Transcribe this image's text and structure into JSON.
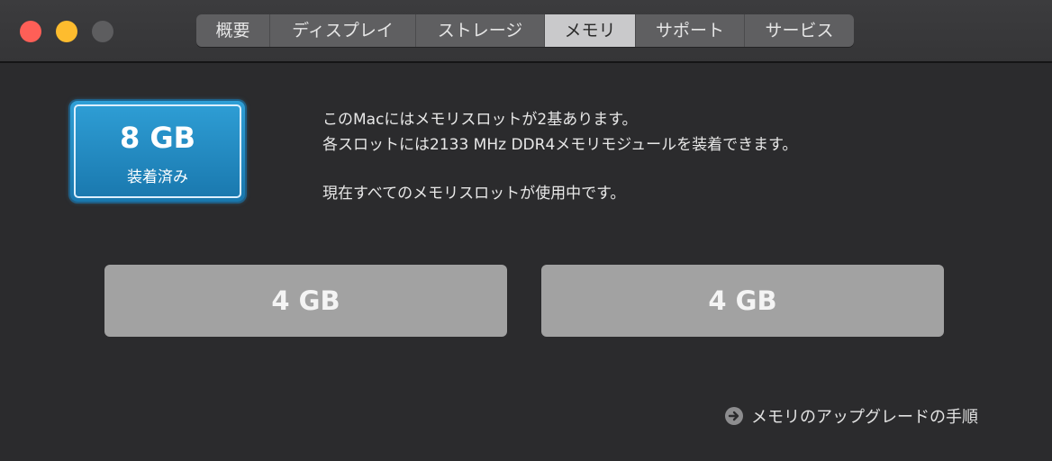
{
  "window": {
    "controls": [
      "close",
      "minimize",
      "zoom"
    ],
    "colors": {
      "close": "#fe5f57",
      "minimize": "#febc2e",
      "zoom": "#5d5d5f"
    }
  },
  "tabs": [
    {
      "label": "概要",
      "selected": false
    },
    {
      "label": "ディスプレイ",
      "selected": false
    },
    {
      "label": "ストレージ",
      "selected": false
    },
    {
      "label": "メモリ",
      "selected": true
    },
    {
      "label": "サポート",
      "selected": false
    },
    {
      "label": "サービス",
      "selected": false
    }
  ],
  "summary": {
    "size": "8 GB",
    "label": "装着済み"
  },
  "info": {
    "line1": "このMacにはメモリスロットが2基あります。",
    "line2": "各スロットには2133 MHz DDR4メモリモジュールを装着できます。",
    "line3": "現在すべてのメモリスロットが使用中です。"
  },
  "slots": [
    {
      "size": "4 GB"
    },
    {
      "size": "4 GB"
    }
  ],
  "upgrade_link": {
    "icon": "arrow-circle-right-icon",
    "label": "メモリのアップグレードの手順"
  }
}
